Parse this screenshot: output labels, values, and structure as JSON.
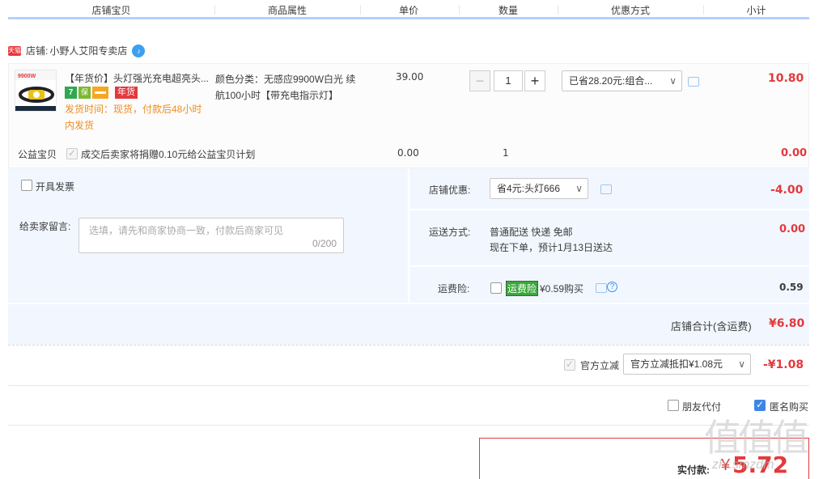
{
  "header": {
    "cols": [
      "店铺宝贝",
      "商品属性",
      "单价",
      "数量",
      "优惠方式",
      "小计"
    ]
  },
  "shop": {
    "badge": "天猫",
    "label": "店铺:",
    "name": "小野人艾阳专卖店"
  },
  "item": {
    "title": "【年货价】头灯强光充电超亮头...",
    "img_text": "9900W",
    "tags": [
      {
        "icon": "7-day-return-icon",
        "color": "#2fa84f",
        "text": "7"
      },
      {
        "icon": "guarantee-icon",
        "color": "#7cb832",
        "text": "保"
      },
      {
        "icon": "credit-card-icon",
        "color": "#f5a623",
        "text": ""
      },
      {
        "icon": "new-year-badge",
        "color": "#e4393c",
        "text": "年货"
      }
    ],
    "ship_time": "发货时间：现货，付款后48小时内发货",
    "attr_line1": "颜色分类：无感应9900W白光 续",
    "attr_line2": "航100小时【带充电指示灯】",
    "price": "39.00",
    "qty": "1",
    "minus": "−",
    "plus": "+",
    "discount_select": "已省28.20元:组合...",
    "subtotal": "10.80"
  },
  "charity": {
    "label": "公益宝贝",
    "text": "成交后卖家将捐赠0.10元给公益宝贝计划",
    "price": "0.00",
    "qty": "1",
    "subtotal": "0.00"
  },
  "invoice": {
    "label": "开具发票"
  },
  "message": {
    "label": "给卖家留言:",
    "placeholder": "选填，请先和商家协商一致，付款后商家可见",
    "counter": "0/200"
  },
  "shop_discount": {
    "label": "店铺优惠:",
    "select": "省4元:头灯666",
    "amount": "-4.00"
  },
  "shipping": {
    "label": "运送方式:",
    "line1": "普通配送 快递 免邮",
    "line2": "现在下单，预计1月13日送达",
    "amount": "0.00"
  },
  "insurance": {
    "label": "运费险:",
    "tag": "运费险",
    "text": "¥0.59购买",
    "amount": "0.59"
  },
  "shop_total": {
    "label": "店铺合计(含运费)",
    "amount": "¥6.80"
  },
  "official": {
    "label": "官方立减",
    "select": "官方立减抵扣¥1.08元",
    "amount": "-¥1.08"
  },
  "options": {
    "friend_pay": "朋友代付",
    "anonymous": "匿名购买"
  },
  "payment": {
    "label": "实付款:",
    "currency": "¥",
    "amount": "5.72"
  },
  "watermark": {
    "text": "值值值",
    "url": "zhi.smzdm"
  },
  "colors": {
    "accent_red": "#e4393c",
    "header_blue": "#b2d1ff",
    "panel_blue": "#f2f7ff"
  }
}
